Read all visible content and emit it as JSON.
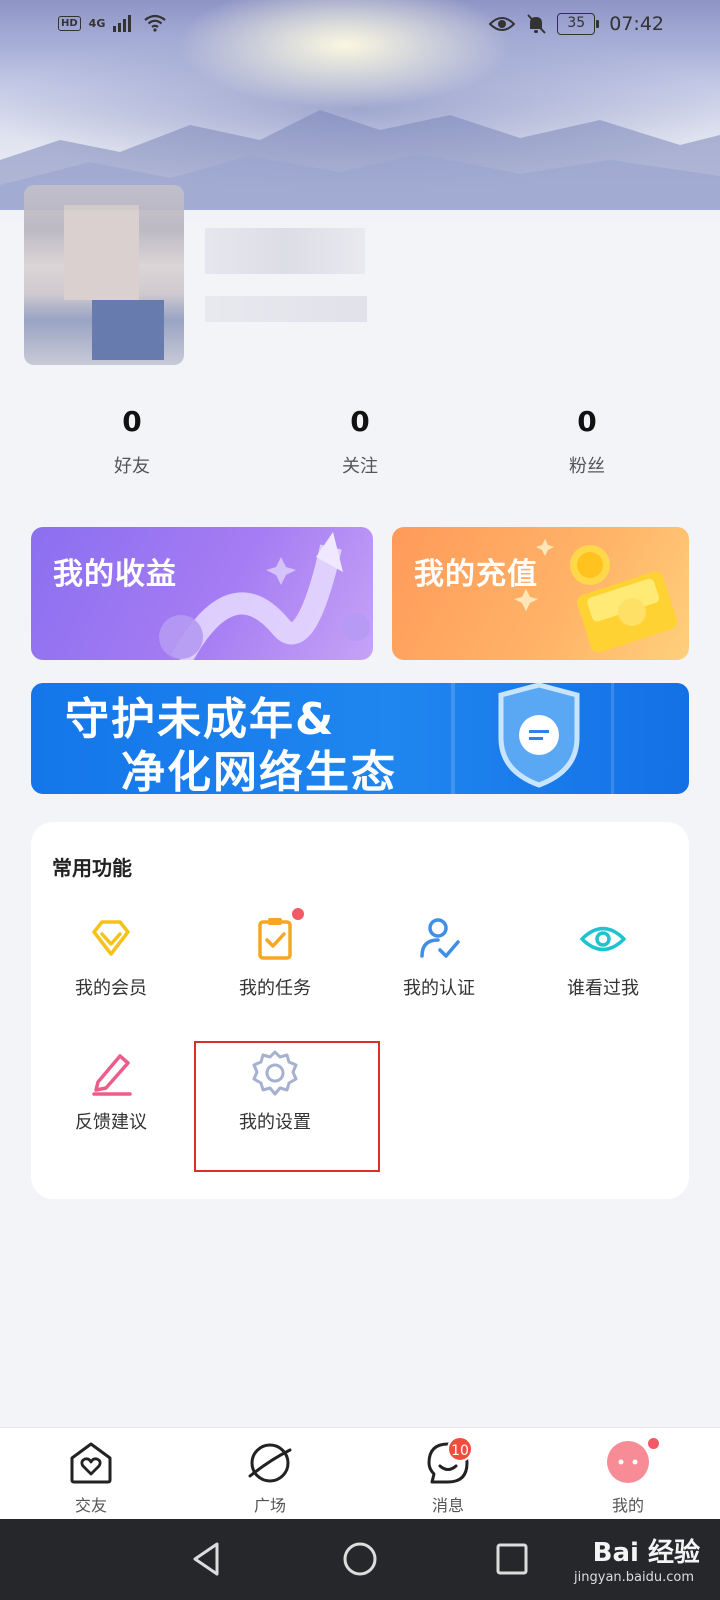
{
  "status_bar": {
    "network": "4G",
    "time": "07:42",
    "battery": "35"
  },
  "stats": [
    {
      "value": "0",
      "label": "好友"
    },
    {
      "value": "0",
      "label": "关注"
    },
    {
      "value": "0",
      "label": "粉丝"
    }
  ],
  "cards": {
    "earnings": "我的收益",
    "recharge": "我的充值"
  },
  "banner": {
    "line1": "守护未成年&",
    "line2": "净化网络生态"
  },
  "functions": {
    "title": "常用功能",
    "items": [
      {
        "label": "我的会员",
        "icon": "diamond-icon"
      },
      {
        "label": "我的任务",
        "icon": "clipboard-check-icon"
      },
      {
        "label": "我的认证",
        "icon": "user-verified-icon"
      },
      {
        "label": "谁看过我",
        "icon": "eye-icon"
      },
      {
        "label": "反馈建议",
        "icon": "pen-icon"
      },
      {
        "label": "我的设置",
        "icon": "gear-icon"
      }
    ]
  },
  "bottom_nav": [
    {
      "label": "交友",
      "icon": "home-heart-icon"
    },
    {
      "label": "广场",
      "icon": "planet-icon"
    },
    {
      "label": "消息",
      "icon": "smile-chat-icon",
      "badge": "10"
    },
    {
      "label": "我的",
      "icon": "profile-blob-icon"
    }
  ],
  "watermark": {
    "brand": "Bai 经验",
    "url": "jingyan.baidu.com"
  },
  "colors": {
    "purple_card": "#8b6ff0",
    "orange_card": "#ff9a5a",
    "banner_blue": "#1476ea",
    "badge_red": "#f24c3d",
    "highlight_red": "#d6312b"
  }
}
